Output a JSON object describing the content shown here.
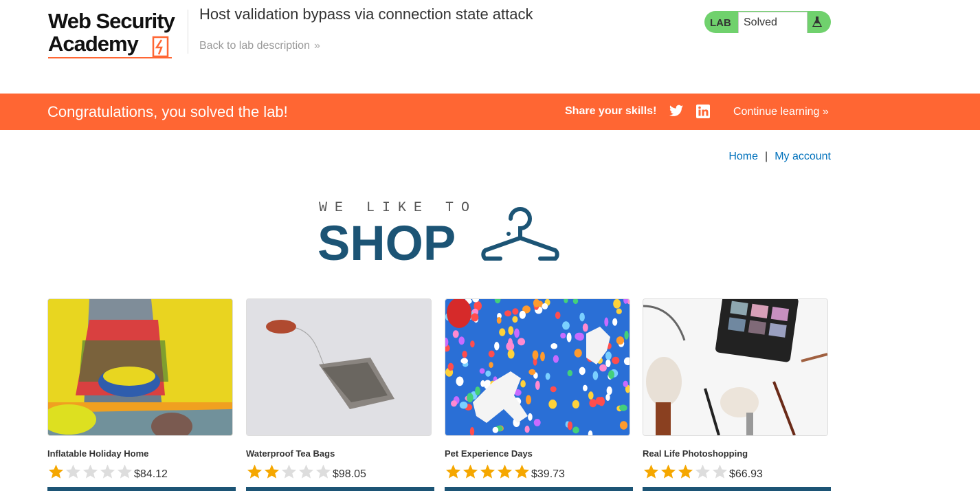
{
  "header": {
    "logo_line1": "Web Security",
    "logo_line2": "Academy",
    "lab_title": "Host validation bypass via connection state attack",
    "back_link": "Back to lab description",
    "lab_tag": "LAB",
    "lab_status": "Solved"
  },
  "banner": {
    "message": "Congratulations, you solved the lab!",
    "share_label": "Share your skills!",
    "continue_label": "Continue learning"
  },
  "nav": {
    "home": "Home",
    "separator": "|",
    "account": "My account"
  },
  "shop_logo": {
    "tagline": "WE LIKE TO",
    "word": "SHOP"
  },
  "products": [
    {
      "name": "Inflatable Holiday Home",
      "stars": 1,
      "price": "$84.12"
    },
    {
      "name": "Waterproof Tea Bags",
      "stars": 2,
      "price": "$98.05"
    },
    {
      "name": "Pet Experience Days",
      "stars": 5,
      "price": "$39.73"
    },
    {
      "name": "Real Life Photoshopping",
      "stars": 3,
      "price": "$66.93"
    }
  ],
  "colors": {
    "brand_orange": "#ff6633",
    "lab_green": "#70d16d",
    "shop_blue": "#1c5475",
    "link_blue": "#0071bc",
    "star_gold": "#f5a700",
    "star_empty": "#dddddd"
  },
  "max_stars": 5
}
